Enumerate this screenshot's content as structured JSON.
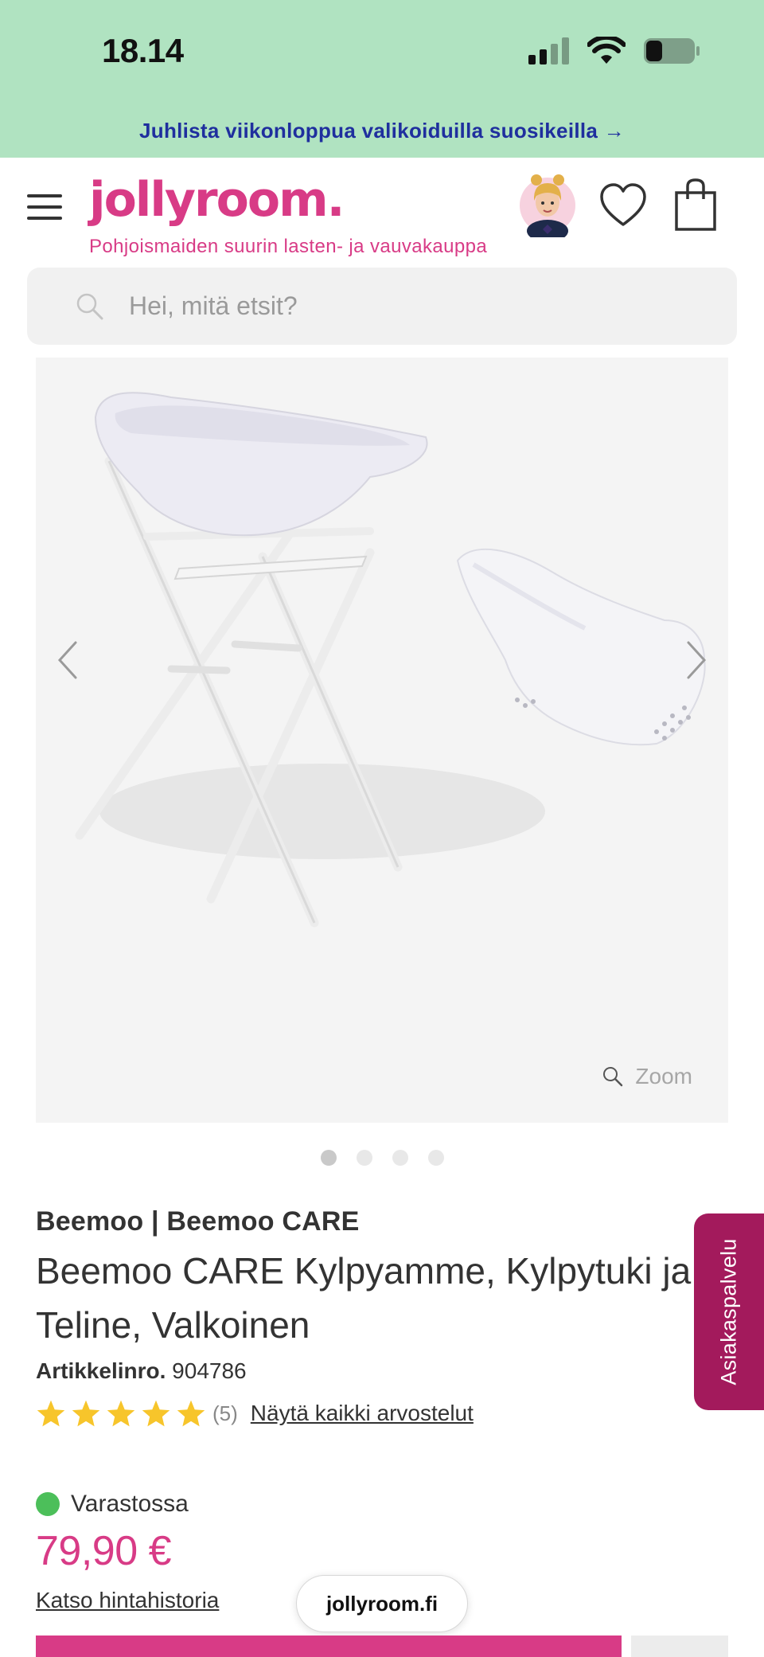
{
  "status_bar": {
    "time": "18.14",
    "battery_level": 0.3
  },
  "promo": {
    "text": "Juhlista viikonloppua valikoiduilla suosikeilla →",
    "background_color": "#b0e3c1",
    "text_color": "#1f2f9e"
  },
  "header": {
    "logo_text": "jollyroom.",
    "tagline": "Pohjoismaiden suurin lasten- ja vauvakauppa",
    "brand_color": "#d83b86",
    "icons": [
      "menu-icon",
      "avatar",
      "heart-icon",
      "shopping-bag-icon"
    ]
  },
  "search": {
    "placeholder": "Hei, mitä etsit?"
  },
  "gallery": {
    "zoom_label": "Zoom",
    "image_count": 4,
    "active_index": 0
  },
  "product": {
    "brand_line": "Beemoo | Beemoo CARE",
    "title_line1": "Beemoo CARE Kylpyamme, Kylpytuki ja",
    "title_line2": "Teline, Valkoinen",
    "article_label": "Artikkelinro.",
    "article_number": "904786",
    "rating": 5,
    "review_count": "(5)",
    "reviews_link": "Näytä kaikki arvostelut",
    "stock_status": "Varastossa",
    "stock_color": "#4cbf5a",
    "price": "79,90 €",
    "price_history_link": "Katso hintahistoria"
  },
  "side_tab": {
    "label": "Asiakaspalvelu",
    "color": "#a31a5c"
  },
  "browser": {
    "url": "jollyroom.fi"
  }
}
